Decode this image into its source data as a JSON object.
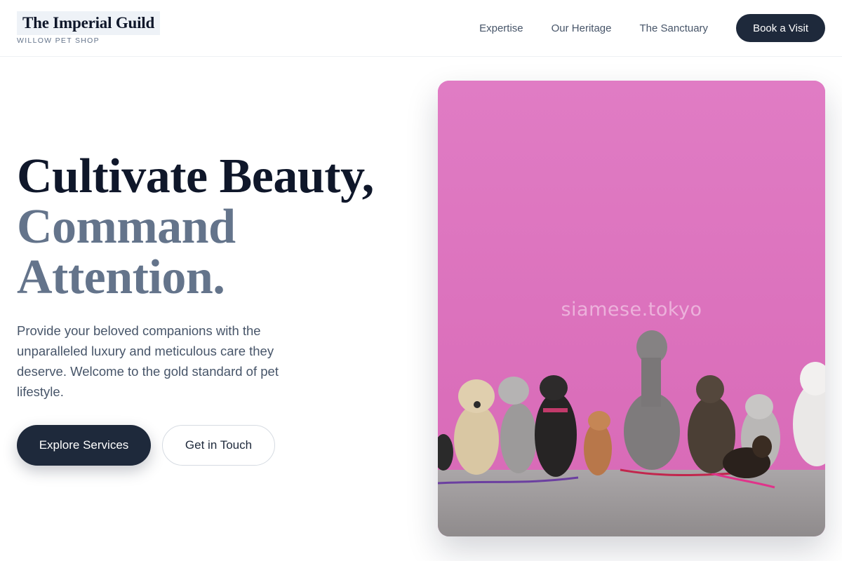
{
  "brand": {
    "title": "The Imperial Guild",
    "subtitle": "WILLOW PET SHOP"
  },
  "nav": {
    "items": [
      {
        "label": "Expertise"
      },
      {
        "label": "Our Heritage"
      },
      {
        "label": "The Sanctuary"
      }
    ],
    "cta_label": "Book a Visit"
  },
  "hero": {
    "headline_line1": "Cultivate Beauty,",
    "headline_line2": "Command",
    "headline_line3": "Attention.",
    "lead": "Provide your beloved companions with the unparalleled luxury and meticulous care they deserve. Welcome to the gold standard of pet lifestyle.",
    "primary_button": "Explore Services",
    "secondary_button": "Get in Touch",
    "image": {
      "watermark": "siamese.tokyo",
      "subject": "dogs-against-pink-wall-photo"
    }
  },
  "colors": {
    "navy": "#1e293b",
    "slate": "#64748b",
    "wall_pink": "#e77fc6",
    "ground_gray": "#a8a4a5"
  }
}
